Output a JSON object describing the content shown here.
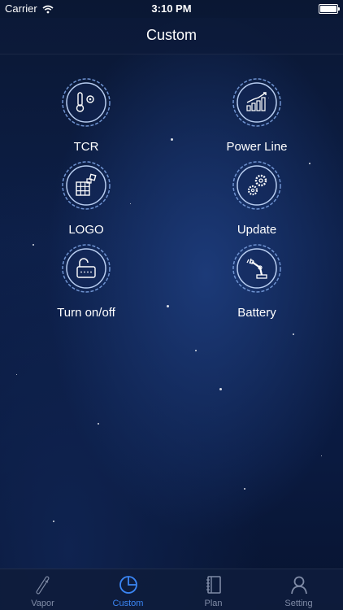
{
  "status_bar": {
    "carrier": "Carrier",
    "time": "3:10 PM"
  },
  "nav": {
    "title": "Custom"
  },
  "grid": [
    {
      "label": "TCR",
      "icon": "thermometer-gear-icon"
    },
    {
      "label": "Power Line",
      "icon": "chart-line-icon"
    },
    {
      "label": "LOGO",
      "icon": "grid-blocks-icon"
    },
    {
      "label": "Update",
      "icon": "gears-icon"
    },
    {
      "label": "Turn on/off",
      "icon": "unlock-icon"
    },
    {
      "label": "Battery",
      "icon": "robot-arm-icon"
    }
  ],
  "tabs": [
    {
      "label": "Vapor",
      "icon": "vape-pen-icon",
      "active": false
    },
    {
      "label": "Custom",
      "icon": "pie-chart-icon",
      "active": true
    },
    {
      "label": "Plan",
      "icon": "notebook-icon",
      "active": false
    },
    {
      "label": "Setting",
      "icon": "user-icon",
      "active": false
    }
  ],
  "colors": {
    "accent": "#3b86f5",
    "inactive": "#7f8ba6",
    "background": "#0d1f48"
  }
}
